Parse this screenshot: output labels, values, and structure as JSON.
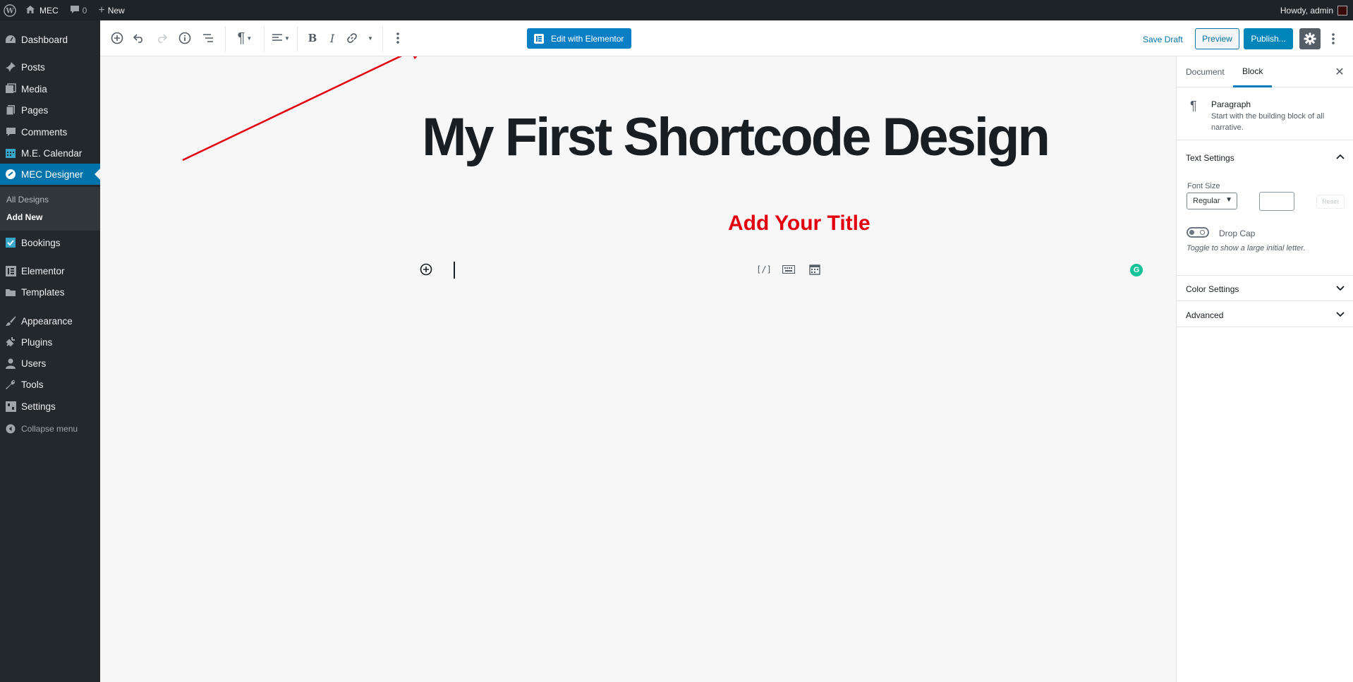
{
  "adminbar": {
    "site_name": "MEC",
    "comments_count": "0",
    "new_label": "New",
    "howdy": "Howdy, admin"
  },
  "sidebar": {
    "items": [
      {
        "label": "Dashboard",
        "icon": "dashboard-icon"
      },
      {
        "label": "Posts",
        "icon": "pin-icon"
      },
      {
        "label": "Media",
        "icon": "media-icon"
      },
      {
        "label": "Pages",
        "icon": "pages-icon"
      },
      {
        "label": "Comments",
        "icon": "comment-icon"
      },
      {
        "label": "M.E. Calendar",
        "icon": "calendar-icon"
      },
      {
        "label": "MEC Designer",
        "icon": "designer-icon"
      },
      {
        "label": "Bookings",
        "icon": "bookings-icon"
      },
      {
        "label": "Elementor",
        "icon": "elementor-icon"
      },
      {
        "label": "Templates",
        "icon": "folder-icon"
      },
      {
        "label": "Appearance",
        "icon": "brush-icon"
      },
      {
        "label": "Plugins",
        "icon": "plugin-icon"
      },
      {
        "label": "Users",
        "icon": "user-icon"
      },
      {
        "label": "Tools",
        "icon": "wrench-icon"
      },
      {
        "label": "Settings",
        "icon": "settings-icon"
      }
    ],
    "submenu": [
      "All Designs",
      "Add New"
    ],
    "collapse_label": "Collapse menu",
    "accent": "#0073aa"
  },
  "toolbar": {
    "edit_with_elementor": "Edit with Elementor",
    "save_draft": "Save Draft",
    "preview": "Preview",
    "publish": "Publish..."
  },
  "editor": {
    "title": "My First Shortcode Design",
    "annotation": "Add Your Title",
    "annotation_color": "#e3000f"
  },
  "panel": {
    "tabs": [
      "Document",
      "Block"
    ],
    "active_tab": "Block",
    "block_name": "Paragraph",
    "block_desc": "Start with the building block of all narrative.",
    "text_settings": "Text Settings",
    "font_size_label": "Font Size",
    "font_size_value": "Regular",
    "reset_label": "Reset",
    "drop_cap_label": "Drop Cap",
    "drop_cap_help": "Toggle to show a large initial letter.",
    "color_settings": "Color Settings",
    "advanced": "Advanced"
  }
}
